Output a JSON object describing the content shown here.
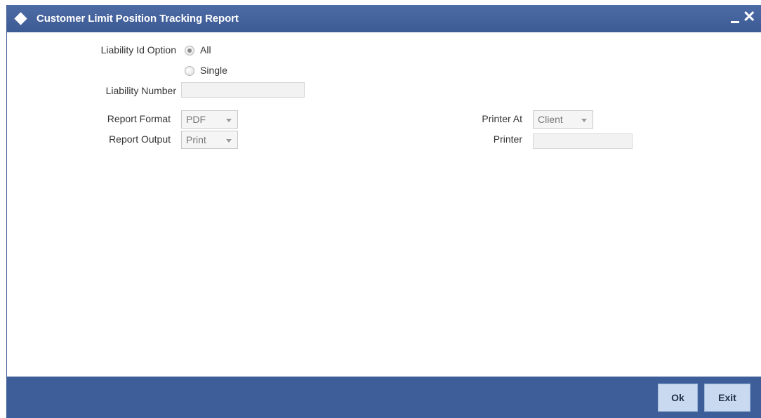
{
  "window": {
    "title": "Customer Limit Position Tracking Report",
    "minimize_label": "minimize",
    "close_label": "close"
  },
  "form": {
    "liability_id_option": {
      "label": "Liability Id Option",
      "options": [
        {
          "label": "All",
          "checked": true
        },
        {
          "label": "Single",
          "checked": false
        }
      ]
    },
    "liability_number": {
      "label": "Liability Number",
      "value": ""
    },
    "report_format": {
      "label": "Report Format",
      "value": "PDF"
    },
    "report_output": {
      "label": "Report Output",
      "value": "Print"
    },
    "printer_at": {
      "label": "Printer At",
      "value": "Client"
    },
    "printer": {
      "label": "Printer",
      "value": ""
    }
  },
  "footer": {
    "ok_label": "Ok",
    "exit_label": "Exit"
  },
  "colors": {
    "titlebar": "#3e5a91",
    "footer": "#3e5e99",
    "button_bg": "#c9d9ef"
  }
}
